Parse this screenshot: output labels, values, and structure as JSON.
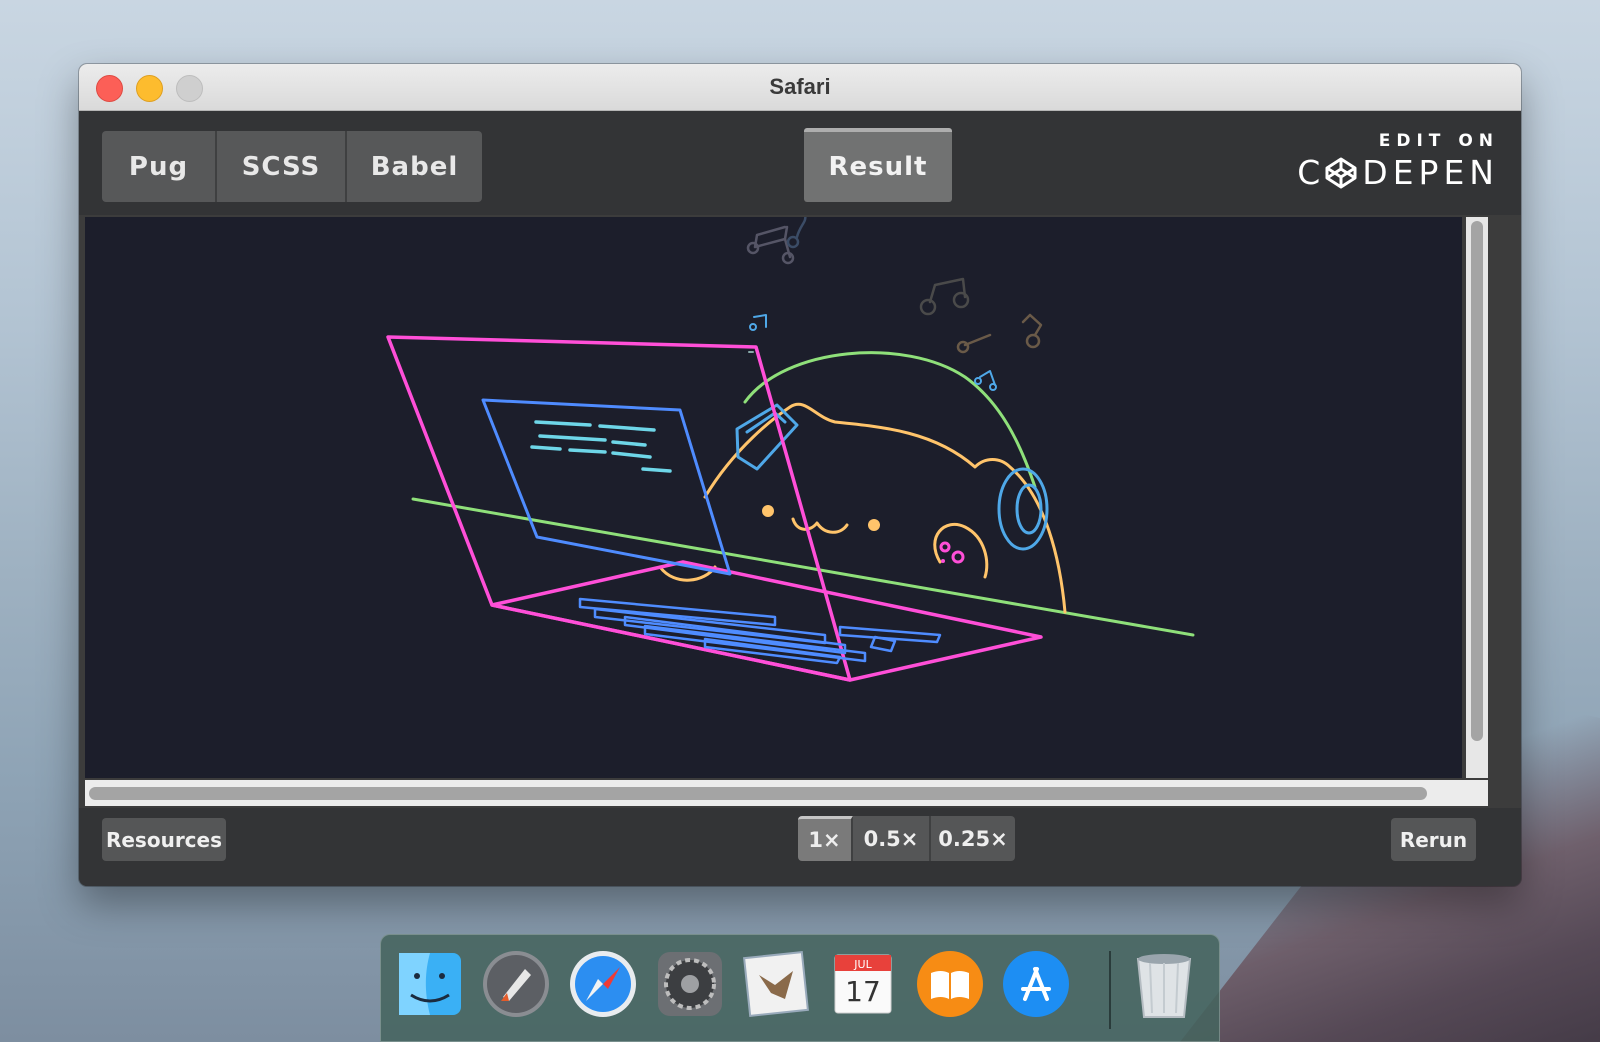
{
  "window": {
    "title": "Safari"
  },
  "editor": {
    "tabs": [
      {
        "label": "Pug"
      },
      {
        "label": "SCSS"
      },
      {
        "label": "Babel"
      }
    ],
    "result_tab": "Result",
    "branding": {
      "edit_on": "EDIT ON",
      "logo_word": "CDEPEN"
    }
  },
  "footer": {
    "resources_label": "Resources",
    "zoom_options": [
      {
        "label": "1×",
        "selected": true
      },
      {
        "label": "0.5×"
      },
      {
        "label": "0.25×"
      }
    ],
    "rerun_label": "Rerun"
  },
  "dock": {
    "items": [
      {
        "name": "finder-icon"
      },
      {
        "name": "launchpad-icon"
      },
      {
        "name": "safari-icon"
      },
      {
        "name": "system-preferences-icon"
      },
      {
        "name": "mail-icon"
      },
      {
        "name": "calendar-icon",
        "month": "JUL",
        "day": "17"
      },
      {
        "name": "books-icon"
      },
      {
        "name": "app-store-icon"
      },
      {
        "name": "trash-icon"
      }
    ]
  },
  "colors": {
    "stage_bg": "#1c1e2b",
    "laptop_outline": "#ff4fd8",
    "screen_outline": "#4f8cff",
    "desk_line": "#8fe07a",
    "cat_outline": "#ffc46b",
    "headphone_band": "#8fe07a",
    "headphone_cup": "#4fa8e8"
  }
}
